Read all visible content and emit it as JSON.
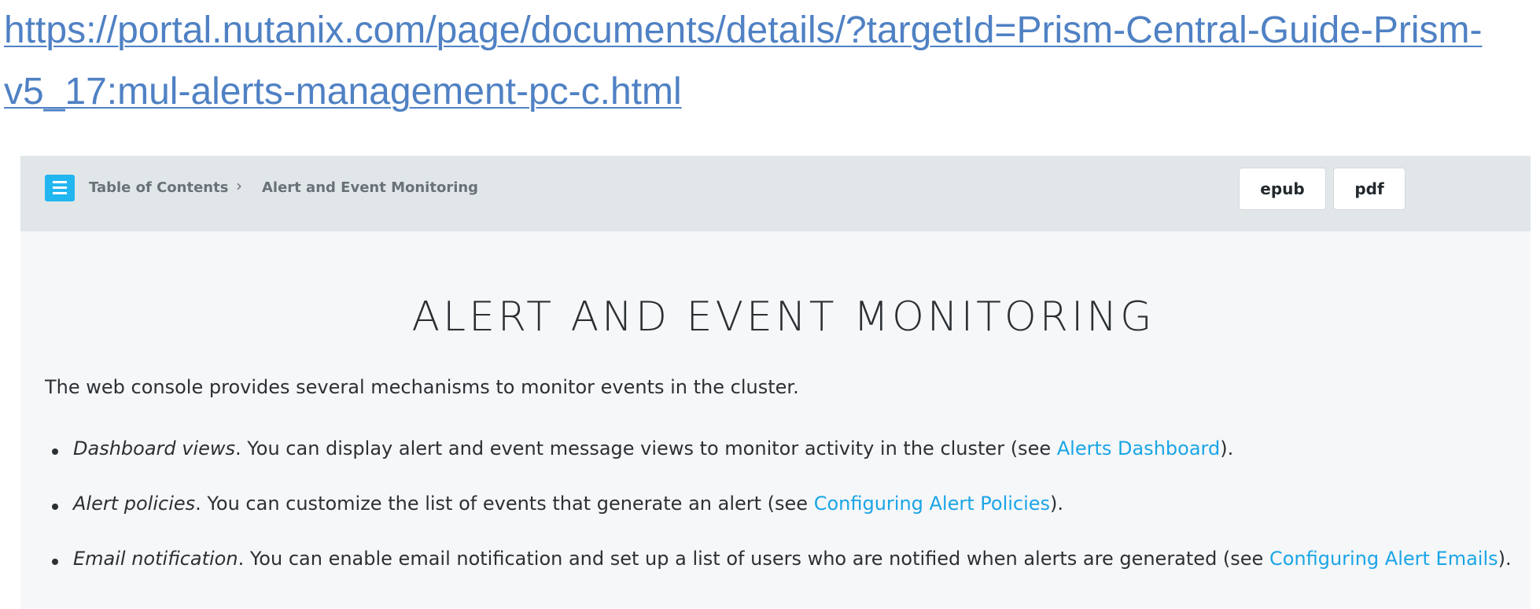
{
  "url": {
    "text": "https://portal.nutanix.com/page/documents/details/?targetId=Prism-Central-Guide-Prism-v5_17:mul-alerts-management-pc-c.html"
  },
  "header": {
    "toc_label": "Table of Contents",
    "separator": "›",
    "current": "Alert and Event Monitoring",
    "epub_label": "epub",
    "pdf_label": "pdf"
  },
  "main": {
    "title": "ALERT AND EVENT MONITORING",
    "intro": "The web console provides several mechanisms to monitor events in the cluster.",
    "items": [
      {
        "term": "Dashboard views",
        "text": ". You can display alert and event message views to monitor activity in the cluster (see ",
        "link": "Alerts Dashboard",
        "end": ")."
      },
      {
        "term": "Alert policies",
        "text": ". You can customize the list of events that generate an alert (see ",
        "link": "Configuring Alert Policies",
        "end": ")."
      },
      {
        "term": "Email notification",
        "text": ". You can enable email notification and set up a list of users who are notified when alerts are generated (see ",
        "link": "Configuring Alert Emails",
        "end": ")."
      }
    ]
  },
  "colors": {
    "url_link": "#4f81c4",
    "doc_link": "#1aa5e6",
    "toc_icon": "#22b6f0",
    "topbar_bg": "#e1e6e9",
    "panel_bg": "#f6f7f9"
  },
  "icons": {
    "toc": "hamburger-menu-icon",
    "separator": "chevron-right-icon"
  }
}
